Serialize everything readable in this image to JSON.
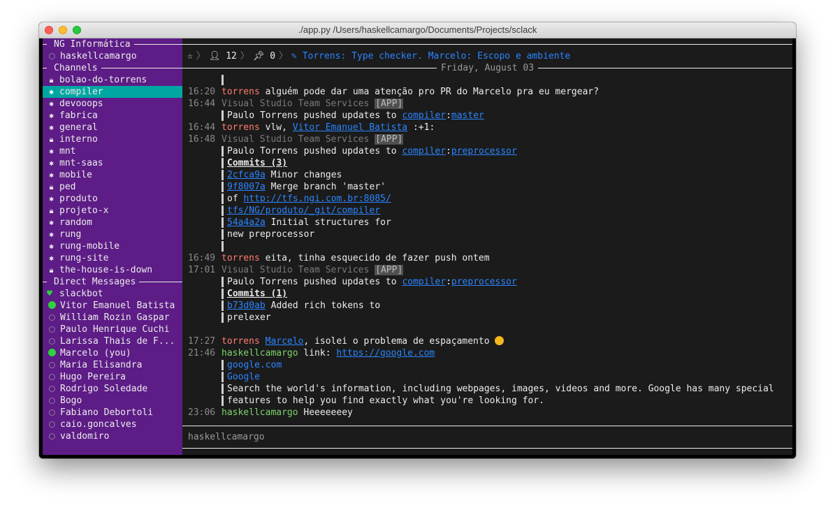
{
  "window": {
    "title": "./app.py  /Users/haskellcamargo/Documents/Projects/sclack"
  },
  "sidebar": {
    "workspace": "NG Informática",
    "user": "haskellcamargo",
    "channels_title": "Channels",
    "channels": [
      {
        "name": "bolao-do-torrens",
        "icon": "lock-icon"
      },
      {
        "name": "compiler",
        "icon": "gear-icon",
        "selected": true
      },
      {
        "name": "devooops",
        "icon": "gear-icon"
      },
      {
        "name": "fabrica",
        "icon": "gear-icon"
      },
      {
        "name": "general",
        "icon": "gear-icon"
      },
      {
        "name": "interno",
        "icon": "lock-icon",
        "bold": true
      },
      {
        "name": "mnt",
        "icon": "gear-icon"
      },
      {
        "name": "mnt-saas",
        "icon": "gear-icon"
      },
      {
        "name": "mobile",
        "icon": "gear-icon"
      },
      {
        "name": "ped",
        "icon": "lock-icon"
      },
      {
        "name": "produto",
        "icon": "gear-icon",
        "bold": true
      },
      {
        "name": "projeto-x",
        "icon": "lock-icon"
      },
      {
        "name": "random",
        "icon": "gear-icon"
      },
      {
        "name": "rung",
        "icon": "gear-icon"
      },
      {
        "name": "rung-mobile",
        "icon": "gear-icon"
      },
      {
        "name": "rung-site",
        "icon": "gear-icon"
      },
      {
        "name": "the-house-is-down",
        "icon": "lock-icon"
      }
    ],
    "dm_title": "Direct Messages",
    "dms": [
      {
        "name": "slackbot",
        "status": "heart"
      },
      {
        "name": "Vitor Emanuel Batista",
        "status": "online"
      },
      {
        "name": "William Rozin Gaspar",
        "status": "away"
      },
      {
        "name": "Paulo Henrique Cuchi",
        "status": "away"
      },
      {
        "name": "Larissa Thais de F...",
        "status": "away"
      },
      {
        "name": "Marcelo (you)",
        "status": "online"
      },
      {
        "name": "Maria Elisandra",
        "status": "away"
      },
      {
        "name": "Hugo Pereira",
        "status": "away"
      },
      {
        "name": "Rodrigo Soledade",
        "status": "away"
      },
      {
        "name": "Bogo",
        "status": "away"
      },
      {
        "name": "Fabiano Debortoli",
        "status": "away"
      },
      {
        "name": "caio.goncalves",
        "status": "away"
      },
      {
        "name": "valdomiro",
        "status": "away"
      }
    ]
  },
  "channel": {
    "name": "compiler",
    "members": "12",
    "pinned": "0",
    "topic": "Torrens: Type checker. Marcelo: Escopo e ambiente",
    "date": "Friday, August 03"
  },
  "messages": {
    "m1": {
      "time": "16:20",
      "user": "torrens",
      "text": " alguém pode dar uma atenção pro PR do Marcelo pra eu mergear?"
    },
    "m2": {
      "time": "16:44",
      "user": "Visual Studio Team Services",
      "tag": "[APP]",
      "pre": "Paulo Torrens pushed updates to ",
      "repo": "compiler",
      "sep": ":",
      "branch": "master"
    },
    "m3": {
      "time": "16:44",
      "user": "torrens",
      "pre": " vlw, ",
      "mention": "Vitor Emanuel Batista",
      "post": " :+1:"
    },
    "m4": {
      "time": "16:48",
      "user": "Visual Studio Team Services",
      "tag": "[APP]",
      "pre": "Paulo Torrens pushed updates to ",
      "repo": "compiler",
      "sep": ":",
      "branch": "preprocessor",
      "commits": "Commits (3)",
      "c1_hash": "2cfca9a",
      "c1_msg": " Minor changes",
      "c2_hash": "9f8007a",
      "c2_msg": " Merge branch 'master'",
      "c2_of": "of ",
      "c2_url1": "http://tfs.ngi.com.br:8085/",
      "c2_url2": "tfs/NG/produto/_git/compiler",
      "c3_hash": "54a4a2a",
      "c3_msg": " Initial structures for",
      "c3_msg2": "new preprocessor"
    },
    "m5": {
      "time": "16:49",
      "user": "torrens",
      "text": " eita, tinha esquecido de fazer push ontem"
    },
    "m6": {
      "time": "17:01",
      "user": "Visual Studio Team Services",
      "tag": "[APP]",
      "pre": "Paulo Torrens pushed updates to ",
      "repo": "compiler",
      "sep": ":",
      "branch": "preprocessor",
      "commits": "Commits (1)",
      "c1_hash": "b73d0ab",
      "c1_msg": " Added rich tokens to",
      "c1_msg2": "prelexer"
    },
    "m7": {
      "time": "17:27",
      "user": "torrens",
      "pre": " ",
      "mention": "Marcelo",
      "post": ", isolei o problema de espaçamento "
    },
    "m8": {
      "time": "21:46",
      "user": "haskellcamargo",
      "pre": " link: ",
      "url": "https://google.com",
      "site": "google.com",
      "site_title": "Google",
      "desc1": "Search the world's information, including webpages, images, videos and more. Google has many special",
      "desc2": "features to help you find exactly what you're looking for."
    },
    "m9": {
      "time": "23:06",
      "user": "haskellcamargo",
      "text": " Heeeeeeey"
    }
  },
  "composer": {
    "value": "haskellcamargo"
  },
  "colors": {
    "sidebar": "#5d1c86",
    "selected": "#00a7a2",
    "link": "#2a85ff",
    "torrens": "#ff7d6e",
    "haskell": "#7dd36b",
    "online": "#2ed23c"
  }
}
